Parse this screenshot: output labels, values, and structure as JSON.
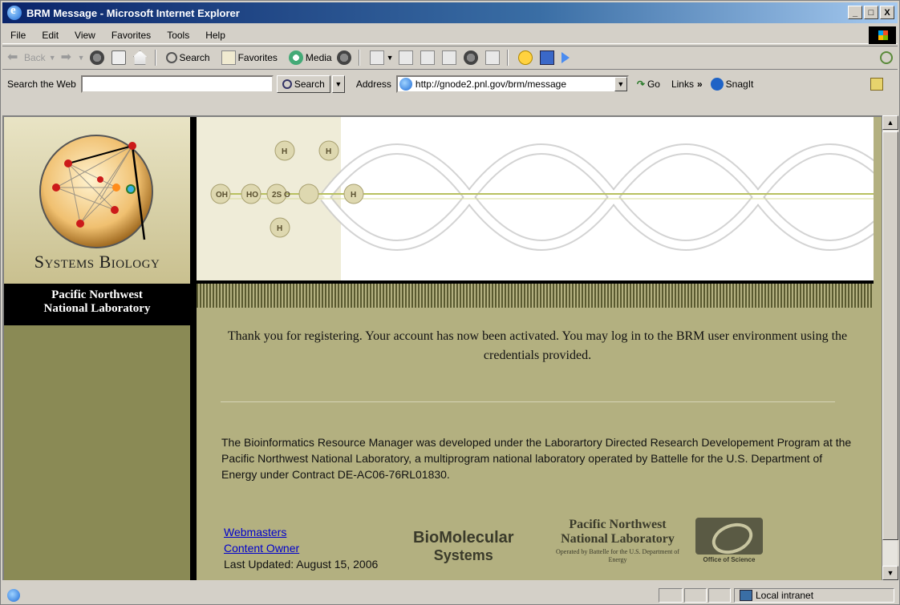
{
  "window": {
    "title": "BRM Message - Microsoft Internet Explorer",
    "controls": [
      "_",
      "□",
      "X"
    ]
  },
  "menu": [
    "File",
    "Edit",
    "View",
    "Favorites",
    "Tools",
    "Help"
  ],
  "toolbar": {
    "back": "Back",
    "search": "Search",
    "favorites": "Favorites",
    "media": "Media"
  },
  "addressbar": {
    "search_label": "Search the Web",
    "search_value": "",
    "search_button": "Search",
    "address_label": "Address",
    "url": "http://gnode2.pnl.gov/brm/message",
    "go": "Go",
    "links": "Links",
    "links_chevron": "»",
    "snagit": "SnagIt"
  },
  "page": {
    "left_title": "Systems Biology",
    "lab_line1": "Pacific Northwest",
    "lab_line2": "National Laboratory",
    "message": "Thank you for registering. Your account has now been activated. You may log in to the BRM user environment using the credentials provided.",
    "about": "The Bioinformatics Resource Manager was developed under the Laborartory Directed Research Developement Program at the Pacific Northwest National Laboratory, a multiprogram national laboratory operated by Battelle for the U.S. Department of Energy under Contract DE-AC06-76RL01830.",
    "link_webmasters": "Webmasters",
    "link_content_owner": "Content Owner",
    "last_updated": "Last Updated: August 15, 2006",
    "logo_biomol_1": "BioMolecular",
    "logo_biomol_2": "Systems",
    "logo_pnnl_1": "Pacific Northwest",
    "logo_pnnl_2": "National Laboratory",
    "logo_pnnl_3": "Operated by Battelle for the U.S. Department of Energy",
    "logo_office": "Office of Science"
  },
  "status": {
    "zone": "Local intranet"
  }
}
